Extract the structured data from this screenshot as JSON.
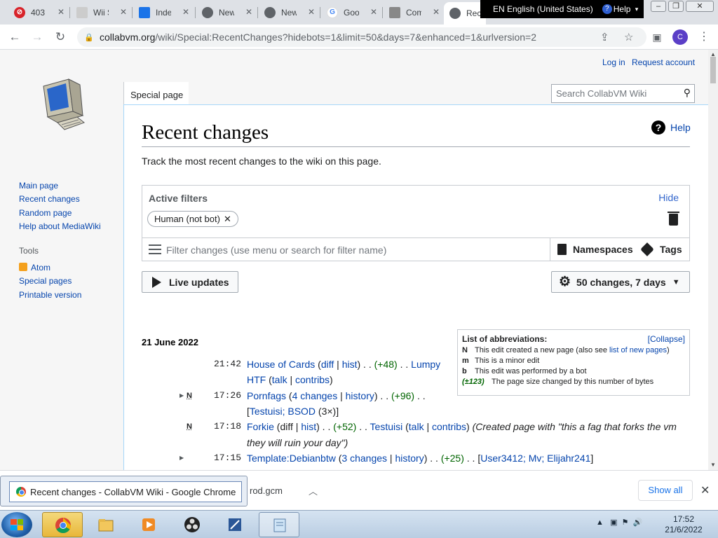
{
  "browser": {
    "tabs": [
      {
        "label": "403"
      },
      {
        "label": "Wii S"
      },
      {
        "label": "Inde"
      },
      {
        "label": "New"
      },
      {
        "label": "New"
      },
      {
        "label": "Goo"
      },
      {
        "label": "Com"
      },
      {
        "label": "Rec"
      }
    ],
    "lang_bar": {
      "label": "EN English (United States)",
      "help": "Help"
    },
    "url_host": "collabvm.org",
    "url_path": "/wiki/Special:RecentChanges?hidebots=1&limit=50&days=7&enhanced=1&urlversion=2",
    "profile_initial": "C"
  },
  "wiki": {
    "personal": {
      "login": "Log in",
      "request": "Request account"
    },
    "tab_special": "Special page",
    "search_placeholder": "Search CollabVM Wiki",
    "sidebar": {
      "nav": [
        "Main page",
        "Recent changes",
        "Random page",
        "Help about MediaWiki"
      ],
      "tools_heading": "Tools",
      "tools": [
        "Atom",
        "Special pages",
        "Printable version"
      ]
    },
    "title": "Recent changes",
    "help": "Help",
    "intro": "Track the most recent changes to the wiki on this page.",
    "filters": {
      "title": "Active filters",
      "hide": "Hide",
      "chip": "Human (not bot)",
      "placeholder": "Filter changes (use menu or search for filter name)",
      "namespaces": "Namespaces",
      "tags": "Tags"
    },
    "live_updates": "Live updates",
    "changes_limit": "50 changes, 7 days",
    "abbreviations": {
      "heading": "List of abbreviations:",
      "collapse": "[Collapse]",
      "rows": [
        {
          "key": "N",
          "text": "This edit created a new page (also see ",
          "link": "list of new pages",
          "tail": ")"
        },
        {
          "key": "m",
          "text": "This is a minor edit"
        },
        {
          "key": "b",
          "text": "This edit was performed by a bot"
        },
        {
          "key": "(±123)",
          "text": "The page size changed by this number of bytes"
        }
      ]
    },
    "day": "21 June 2022",
    "entries": {
      "e1": {
        "time": "21:42",
        "page": "House of Cards",
        "diff": "diff",
        "hist": "hist",
        "size": "(+48)",
        "user": "Lumpy HTF",
        "user1": "Lumpy",
        "user2": "HTF",
        "talk": "talk",
        "contribs": "contribs"
      },
      "e2": {
        "time": "17:26",
        "flag": "N",
        "page": "Pornfags",
        "changes": "4 changes",
        "history": "history",
        "size": "(+96)",
        "users": "Testuisi; BSOD",
        "count": "(3×)"
      },
      "e3": {
        "time": "17:18",
        "flag": "N",
        "page": "Forkie",
        "diff": "diff",
        "hist": "hist",
        "size": "(+52)",
        "user": "Testuisi",
        "talk": "talk",
        "contribs": "contribs",
        "summary": "(Created page with \"this a fag that forks the vm they will ruin your day\")",
        "summary1": "(Created page with \"this a fag that forks the vm",
        "summary2": "they will ruin your day\")"
      },
      "e4": {
        "time": "17:15",
        "page": "Template:Debianbtw",
        "changes": "3 changes",
        "history": "history",
        "size": "(+25)",
        "users": "User3412; Mv; Elijahr241"
      }
    }
  },
  "downloads": {
    "item": "rod.gcm",
    "show_all": "Show all",
    "tooltip": "Recent changes - CollabVM Wiki - Google Chrome"
  },
  "taskbar": {
    "time": "17:52",
    "date": "21/6/2022"
  }
}
